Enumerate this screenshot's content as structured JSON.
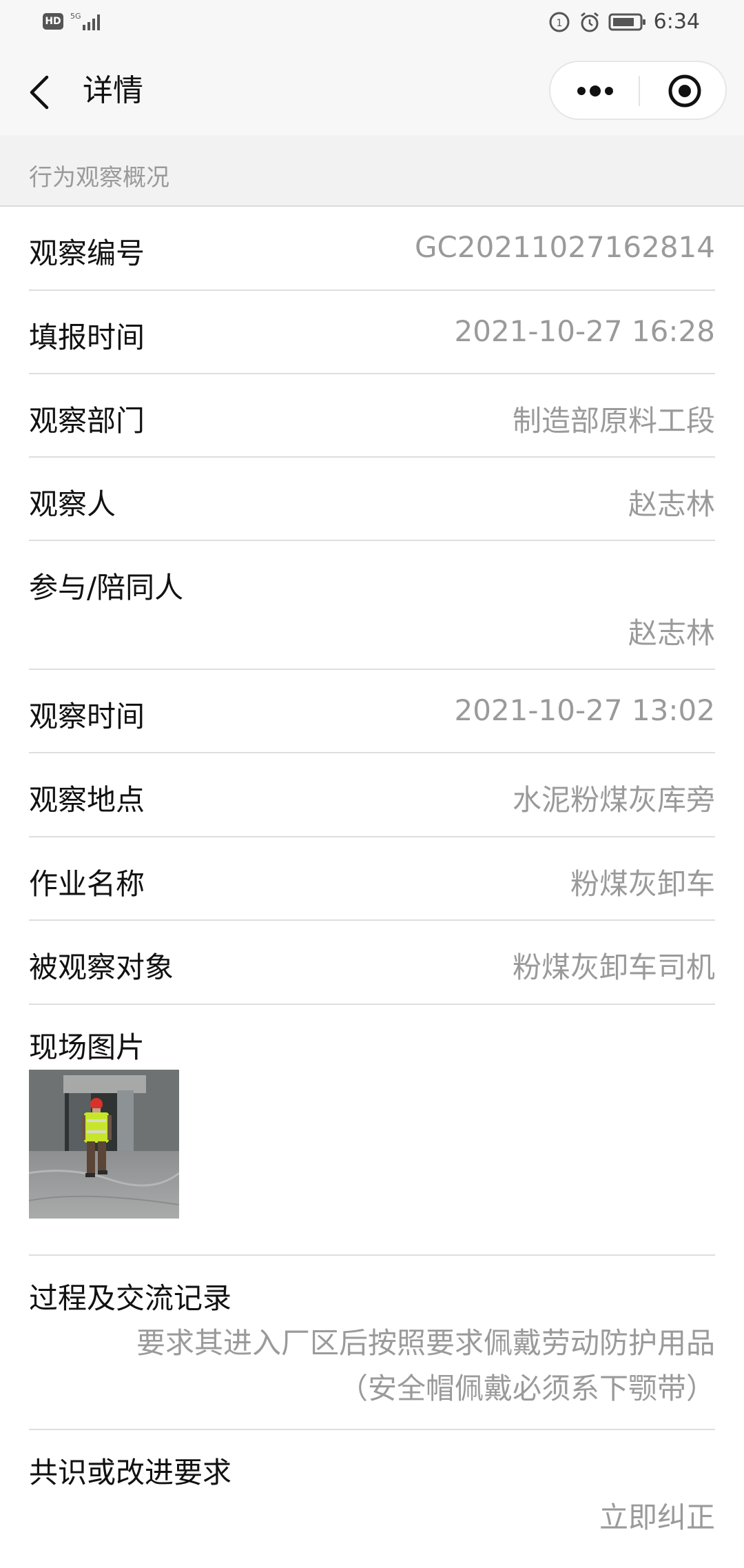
{
  "status_bar": {
    "network": "5G",
    "hd": "HD",
    "time": "6:34"
  },
  "nav": {
    "title": "详情",
    "back_icon": "chevron-left-icon",
    "more_icon": "more-dots-icon",
    "close_icon": "target-circle-icon"
  },
  "section": {
    "title": "行为观察概况"
  },
  "fields": [
    {
      "label": "观察编号",
      "value": "GC20211027162814"
    },
    {
      "label": "填报时间",
      "value": "2021-10-27 16:28"
    },
    {
      "label": "观察部门",
      "value": "制造部原料工段"
    },
    {
      "label": "观察人",
      "value": "赵志林"
    },
    {
      "label": "参与/陪同人",
      "value": "赵志林"
    },
    {
      "label": "观察时间",
      "value": "2021-10-27 13:02"
    },
    {
      "label": "观察地点",
      "value": "水泥粉煤灰库旁"
    },
    {
      "label": "作业名称",
      "value": "粉煤灰卸车"
    },
    {
      "label": "被观察对象",
      "value": "粉煤灰卸车司机"
    }
  ],
  "photo_section": {
    "label": "现场图片"
  },
  "process": {
    "label": "过程及交流记录",
    "line1": "要求其进入厂区后按照要求佩戴劳动防护用品",
    "line2": "（安全帽佩戴必须系下颚带）"
  },
  "consensus": {
    "label": "共识或改进要求",
    "value": "立即纠正"
  }
}
